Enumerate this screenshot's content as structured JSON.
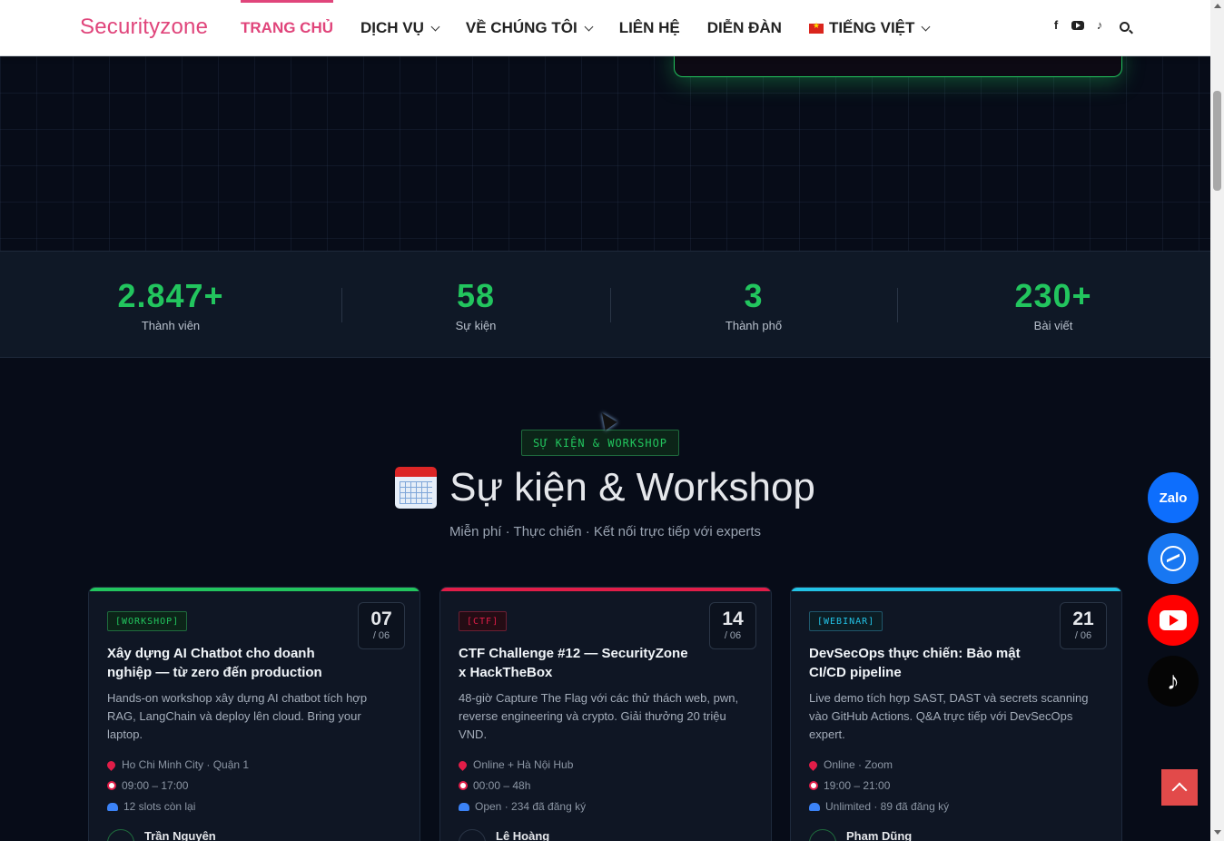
{
  "nav": {
    "logo": "Securityzone",
    "items": [
      {
        "label": "TRANG CHỦ",
        "active": true,
        "dropdown": false
      },
      {
        "label": "DỊCH VỤ",
        "active": false,
        "dropdown": true
      },
      {
        "label": "VỀ CHÚNG TÔI",
        "active": false,
        "dropdown": true
      },
      {
        "label": "LIÊN HỆ",
        "active": false,
        "dropdown": false
      },
      {
        "label": "DIỄN ĐÀN",
        "active": false,
        "dropdown": false
      }
    ],
    "language": "TIẾNG VIỆT",
    "social_icons": [
      "facebook-icon",
      "youtube-icon",
      "tiktok-icon"
    ],
    "accent_color": "#e0457b"
  },
  "stats": [
    {
      "value": "2.847+",
      "label": "Thành viên"
    },
    {
      "value": "58",
      "label": "Sự kiện"
    },
    {
      "value": "3",
      "label": "Thành phố"
    },
    {
      "value": "230+",
      "label": "Bài viết"
    }
  ],
  "events": {
    "badge": "SỰ KIỆN & WORKSHOP",
    "title": "Sự kiện & Workshop",
    "subtitle": "Miễn phí · Thực chiến · Kết nối trực tiếp với experts",
    "cards": [
      {
        "tag": "[WORKSHOP]",
        "color": "#22c55e",
        "day": "07",
        "month": "/ 06",
        "title": "Xây dựng AI Chatbot cho doanh nghiệp — từ zero đến production",
        "description": "Hands-on workshop xây dựng AI chatbot tích hợp RAG, LangChain và deploy lên cloud. Bring your laptop.",
        "location": "Ho Chi Minh City · Quận 1",
        "time": "09:00 – 17:00",
        "slots": "12 slots còn lại",
        "author": "Trần Nguyên"
      },
      {
        "tag": "[CTF]",
        "color": "#e11d48",
        "day": "14",
        "month": "/ 06",
        "title": "CTF Challenge #12 — SecurityZone x HackTheBox",
        "description": "48-giờ Capture The Flag với các thử thách web, pwn, reverse engineering và crypto. Giải thưởng 20 triệu VND.",
        "location": "Online + Hà Nội Hub",
        "time": "00:00 – 48h",
        "slots": "Open · 234 đã đăng ký",
        "author": "Lê Hoàng"
      },
      {
        "tag": "[WEBINAR]",
        "color": "#22c3e6",
        "day": "21",
        "month": "/ 06",
        "title": "DevSecOps thực chiến: Bảo mật CI/CD pipeline",
        "description": "Live demo tích hợp SAST, DAST và secrets scanning vào GitHub Actions. Q&A trực tiếp với DevSecOps expert.",
        "location": "Online · Zoom",
        "time": "19:00 – 21:00",
        "slots": "Unlimited · 89 đã đăng ký",
        "author": "Phạm Dũng"
      }
    ]
  },
  "floating": {
    "zalo_label": "Zalo",
    "buttons": [
      "zalo-icon",
      "messenger-icon",
      "youtube-icon",
      "tiktok-icon"
    ],
    "scroll_top_color": "#e24a4a"
  }
}
